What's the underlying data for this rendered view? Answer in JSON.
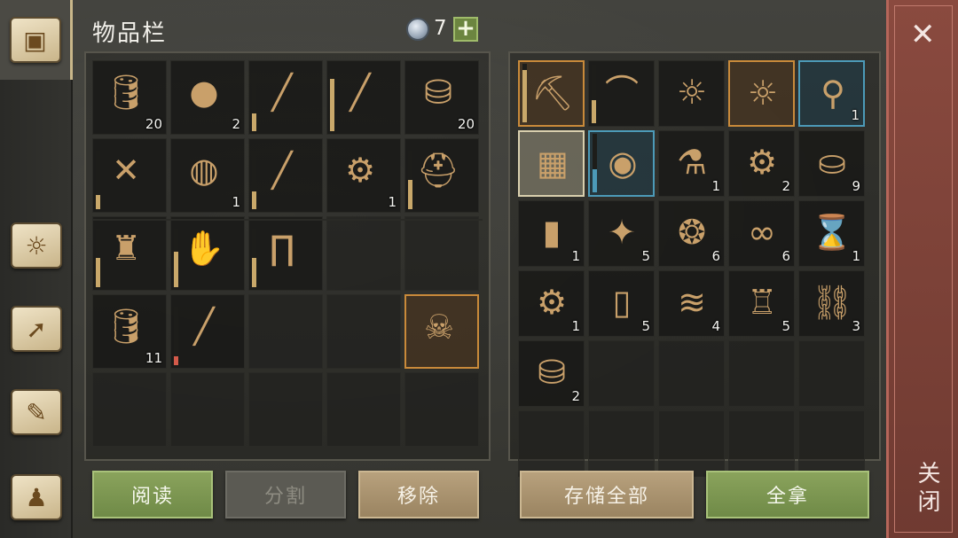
{
  "header": {
    "title": "物品栏",
    "gem_count": "7",
    "plus": "+"
  },
  "sidebar": {
    "tabs": [
      {
        "name": "chest-icon",
        "glyph": "▣"
      },
      {
        "name": "sun-book-icon",
        "glyph": "☼"
      },
      {
        "name": "arrow-icon",
        "glyph": "➚"
      },
      {
        "name": "scroll-quill-icon",
        "glyph": "✎"
      },
      {
        "name": "character-icon",
        "glyph": "♟"
      }
    ]
  },
  "left_grid": [
    [
      {
        "icon": "barrel-icon",
        "glyph": "🛢",
        "qty": "20"
      },
      {
        "icon": "waterskin-icon",
        "glyph": "●",
        "qty": "2"
      },
      {
        "icon": "sword-icon",
        "glyph": "╱",
        "dur": 0.3
      },
      {
        "icon": "sword-icon",
        "glyph": "╱",
        "dur": 0.9
      },
      {
        "icon": "keg-icon",
        "glyph": "⛁",
        "qty": "20"
      }
    ],
    [
      {
        "icon": "crossbow-icon",
        "glyph": "✕",
        "dur": 0.25
      },
      {
        "icon": "berry-bucket-icon",
        "glyph": "◍",
        "qty": "1"
      },
      {
        "icon": "sword-icon",
        "glyph": "╱",
        "dur": 0.3
      },
      {
        "icon": "bear-trap-icon",
        "glyph": "⚙",
        "qty": "1"
      },
      {
        "icon": "knight-helmet-icon",
        "glyph": "⛑",
        "dur": 0.5
      }
    ],
    [
      {
        "icon": "chainmail-icon",
        "glyph": "♜",
        "dur": 0.5
      },
      {
        "icon": "gauntlets-icon",
        "glyph": "✋",
        "dur": 0.6
      },
      {
        "icon": "leggings-icon",
        "glyph": "∏",
        "dur": 0.5
      },
      {},
      {}
    ],
    [
      {
        "icon": "barrel-icon",
        "glyph": "🛢",
        "qty": "11"
      },
      {
        "icon": "sword-icon",
        "glyph": "╱",
        "dur": 0.15,
        "red": true
      },
      {},
      {},
      {
        "icon": "horned-helmet-icon",
        "glyph": "☠",
        "sel": "orange"
      }
    ],
    [
      {},
      {},
      {},
      {},
      {}
    ]
  ],
  "right_grid": [
    [
      {
        "icon": "pickaxe-icon",
        "glyph": "⛏",
        "sel": "orange",
        "dur": 0.9
      },
      {
        "icon": "scimitar-icon",
        "glyph": "⌒",
        "dur": 0.4
      },
      {
        "icon": "sun-book-icon",
        "glyph": "☼"
      },
      {
        "icon": "sun-book-icon",
        "glyph": "☼",
        "sel": "orange"
      },
      {
        "icon": "hook-icon",
        "glyph": "⚲",
        "qty": "1",
        "sel": "blue"
      }
    ],
    [
      {
        "icon": "blueprint-icon",
        "glyph": "▦",
        "sel": "cream"
      },
      {
        "icon": "round-shield-icon",
        "glyph": "◉",
        "sel": "blue",
        "dur": 0.4,
        "blue_bar": true
      },
      {
        "icon": "potion-icon",
        "glyph": "⚗",
        "qty": "1"
      },
      {
        "icon": "gear-icon",
        "glyph": "⚙",
        "qty": "2"
      },
      {
        "icon": "sack-icon",
        "glyph": "⛀",
        "qty": "9"
      }
    ],
    [
      {
        "icon": "bottle-icon",
        "glyph": "▮",
        "qty": "1"
      },
      {
        "icon": "crystal-icon",
        "glyph": "✦",
        "qty": "5"
      },
      {
        "icon": "herb-ball-icon",
        "glyph": "❂",
        "qty": "6"
      },
      {
        "icon": "rope-icon",
        "glyph": "∞",
        "qty": "6"
      },
      {
        "icon": "hourglass-icon",
        "glyph": "⌛",
        "qty": "1"
      }
    ],
    [
      {
        "icon": "bear-trap-icon",
        "glyph": "⚙",
        "qty": "1"
      },
      {
        "icon": "candle-icon",
        "glyph": "▯",
        "qty": "5"
      },
      {
        "icon": "cloth-icon",
        "glyph": "≋",
        "qty": "4"
      },
      {
        "icon": "tankard-icon",
        "glyph": "♖",
        "qty": "5"
      },
      {
        "icon": "chain-icon",
        "glyph": "⛓",
        "qty": "3"
      }
    ],
    [
      {
        "icon": "keg-icon",
        "glyph": "⛁",
        "qty": "2"
      },
      {},
      {},
      {},
      {}
    ],
    [
      {},
      {},
      {},
      {},
      {}
    ]
  ],
  "buttons": {
    "read": "阅读",
    "split": "分割",
    "remove": "移除",
    "store_all": "存储全部",
    "take_all": "全拿"
  },
  "close": {
    "label": "关闭",
    "x": "✕"
  },
  "colors": {
    "green_button": "#7a944f",
    "tan_button": "#a89270",
    "close_panel": "#7d4237",
    "selection_orange": "#c98a3a",
    "selection_blue": "#4c9ab8"
  }
}
